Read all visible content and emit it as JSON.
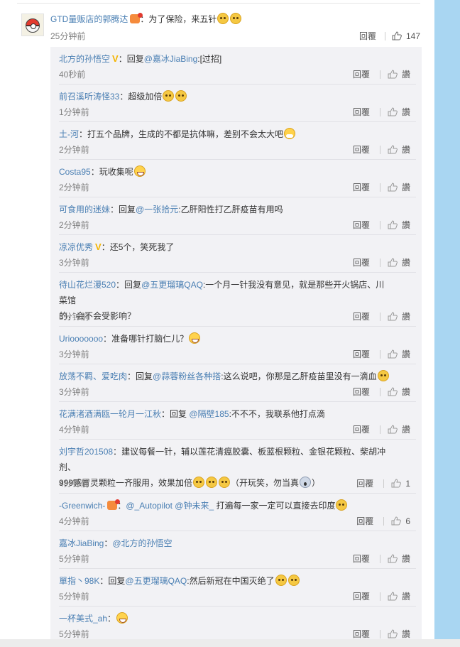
{
  "main": {
    "author": "GTD量贩店的郭腾达",
    "colon": "：",
    "text": "为了保险，来五针",
    "time": "25分钟前",
    "reply_label": "回覆",
    "like_count": "147",
    "avatar_icon": "pokeball-avatar"
  },
  "replies": [
    {
      "author": "北方的孙悟空",
      "badge": "v",
      "sep": "：",
      "prefix": "回复",
      "mention": "@嘉冰JiaBing",
      "text": ":[过招]",
      "text2": "",
      "time": "40秒前",
      "reply": "回覆",
      "like": "讚"
    },
    {
      "author": "前召溪听涛怪33",
      "sep": "：",
      "prefix": "",
      "mention": "",
      "text": "超级加倍",
      "emoji": "cat,cat",
      "time": "1分钟前",
      "reply": "回覆",
      "like": "讚"
    },
    {
      "author": "土-河",
      "sep": "：",
      "prefix": "",
      "mention": "",
      "text": "打五个品牌，生成的不都是抗体嘛，差别不会太大吧",
      "emoji": "mask",
      "time": "2分钟前",
      "reply": "回覆",
      "like": "讚"
    },
    {
      "author": "Costa95",
      "sep": "：",
      "prefix": "",
      "mention": "",
      "text": "玩收集呢",
      "emoji": "laugh",
      "time": "2分钟前",
      "reply": "回覆",
      "like": "讚"
    },
    {
      "author": "可食用的迷妹",
      "sep": "：",
      "prefix": "回复",
      "mention": "@一张拾元",
      "text": ":乙肝阳性打乙肝疫苗有用吗",
      "time": "2分钟前",
      "reply": "回覆",
      "like": "讚"
    },
    {
      "author": "凉凉优秀",
      "badge": "v",
      "sep": "：",
      "prefix": "",
      "mention": "",
      "text": "还5个，笑死我了",
      "time": "3分钟前",
      "reply": "回覆",
      "like": "讚"
    },
    {
      "author": "待山花烂漫520",
      "sep": "：",
      "prefix": "回复",
      "mention": "@五更瑠璃QAQ",
      "text": ":一个月一针我没有意见，就是那些开火锅店、川菜馆",
      "text2": "的，会不会受影响？",
      "time": "3分钟前",
      "reply": "回覆",
      "like": "讚"
    },
    {
      "author": "Uriooooooo",
      "sep": "：",
      "prefix": "",
      "mention": "",
      "text": "准备哪针打脑仁儿？",
      "emoji": "laugh",
      "time": "3分钟前",
      "reply": "回覆",
      "like": "讚"
    },
    {
      "author": "放荡不羁、爱吃肉",
      "sep": "：",
      "prefix": "回复",
      "mention": "@蒜蓉粉丝各种搭",
      "text": ":这么说吧，你那是乙肝疫苗里没有一滴血",
      "emoji": "cat",
      "time": "3分钟前",
      "reply": "回覆",
      "like": "讚"
    },
    {
      "author": "花满渚酒满瓯一轮月一江秋",
      "sep": "：",
      "prefix": "回复 ",
      "mention": "@隔壁185",
      "text": ":不不不，我联系他打点滴",
      "time": "4分钟前",
      "reply": "回覆",
      "like": "讚"
    },
    {
      "author": "刘宇哲201508",
      "sep": "：",
      "prefix": "",
      "mention": "",
      "text": "建议每餐一针，辅以莲花清瘟胶囊、板蓝根颗粒、金银花颗粒、柴胡冲剂、",
      "text2": "999感冒灵颗粒一齐服用，效果加倍",
      "emoji2": "cat,cat,cat",
      "text3": "（开玩笑，勿当真",
      "emoji3": "fear",
      "text4": "）",
      "time": "4分钟前",
      "reply": "回覆",
      "like": "1"
    },
    {
      "author": "-Greenwich-",
      "rbadge": true,
      "sep": "：",
      "prefix": "",
      "mention": "@_Autopilot @钟未来_",
      "text": " 打遍每一家一定可以直接去印度",
      "emoji": "cat",
      "time": "4分钟前",
      "reply": "回覆",
      "like": "6"
    },
    {
      "author": "嘉冰JiaBing",
      "sep": "：",
      "prefix": "",
      "mention": "@北方的孙悟空",
      "text": "",
      "time": "5分钟前",
      "reply": "回覆",
      "like": "讚"
    },
    {
      "author": "單指丶98K",
      "sep": "：",
      "prefix": "回复",
      "mention": "@五更瑠璃QAQ",
      "text": ":然后新冠在中国灭绝了",
      "emoji": "cat,cat",
      "time": "5分钟前",
      "reply": "回覆",
      "like": "讚"
    },
    {
      "author": "一杯美式_ah",
      "sep": "：",
      "prefix": "",
      "mention": "",
      "text": "",
      "emoji": "laugh",
      "time": "5分钟前",
      "reply": "回覆",
      "like": "讚"
    }
  ]
}
